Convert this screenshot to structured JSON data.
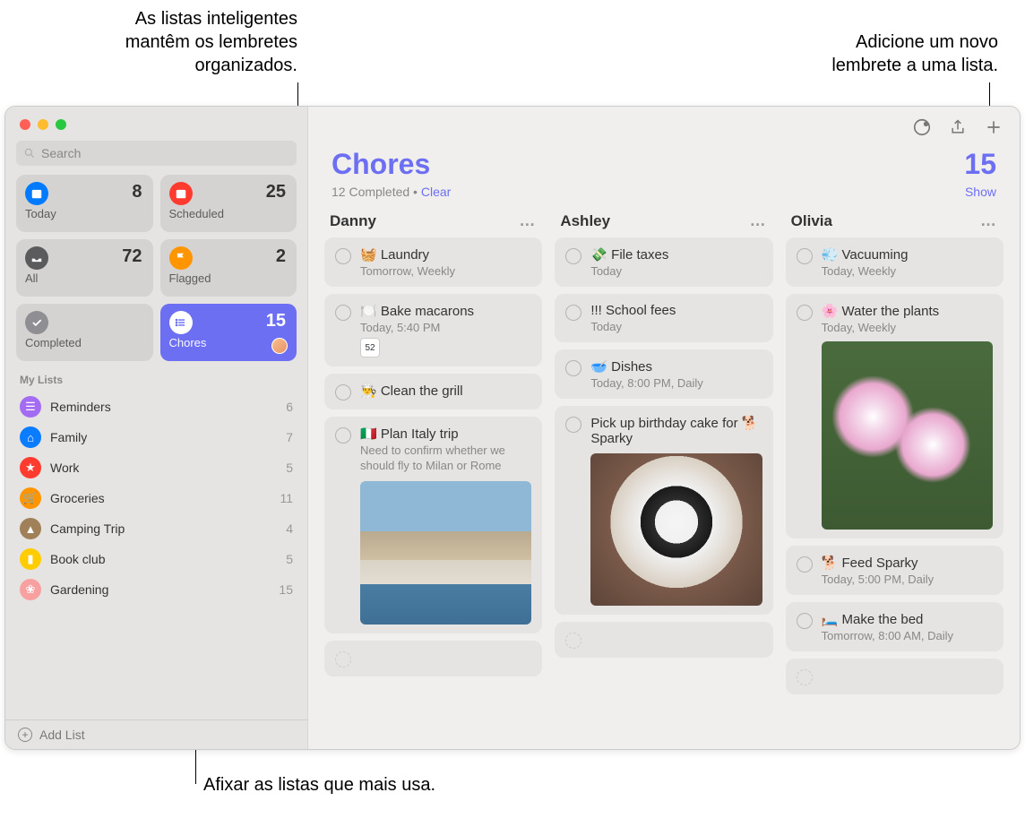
{
  "callouts": {
    "smart": "As listas inteligentes\nmantêm os lembretes\norganizados.",
    "add": "Adicione um novo\nlembrete a uma lista.",
    "pin": "Afixar as listas que mais usa."
  },
  "search": {
    "placeholder": "Search"
  },
  "tiles": [
    {
      "label": "Today",
      "count": "8"
    },
    {
      "label": "Scheduled",
      "count": "25"
    },
    {
      "label": "All",
      "count": "72"
    },
    {
      "label": "Flagged",
      "count": "2"
    },
    {
      "label": "Completed",
      "count": ""
    },
    {
      "label": "Chores",
      "count": "15"
    }
  ],
  "section": "My Lists",
  "lists": [
    {
      "name": "Reminders",
      "count": "6",
      "color": "#a46cf2",
      "glyph": "list"
    },
    {
      "name": "Family",
      "count": "7",
      "color": "#0a7cff",
      "glyph": "home"
    },
    {
      "name": "Work",
      "count": "5",
      "color": "#ff3b30",
      "glyph": "star"
    },
    {
      "name": "Groceries",
      "count": "11",
      "color": "#ff9500",
      "glyph": "cart"
    },
    {
      "name": "Camping Trip",
      "count": "4",
      "color": "#a08058",
      "glyph": "tent"
    },
    {
      "name": "Book club",
      "count": "5",
      "color": "#ffcc00",
      "glyph": "book"
    },
    {
      "name": "Gardening",
      "count": "15",
      "color": "#f8a0a0",
      "glyph": "leaf"
    }
  ],
  "add_list": "Add List",
  "header": {
    "title": "Chores",
    "count": "15",
    "completed": "12 Completed",
    "dot": "  •  ",
    "clear": "Clear",
    "show": "Show"
  },
  "columns": [
    {
      "name": "Danny",
      "items": [
        {
          "emoji": "🧺",
          "title": "Laundry",
          "sub": "Tomorrow, Weekly"
        },
        {
          "emoji": "🍽️",
          "title": "Bake macarons",
          "sub": "Today, 5:40 PM",
          "cal": "52"
        },
        {
          "emoji": "👨‍🍳",
          "title": "Clean the grill"
        },
        {
          "emoji": "🇮🇹",
          "title": "Plan Italy trip",
          "note": "Need to confirm whether we should fly to Milan or Rome",
          "img": "italy"
        },
        {
          "empty": true
        }
      ]
    },
    {
      "name": "Ashley",
      "items": [
        {
          "emoji": "💸",
          "title": "File taxes",
          "sub": "Today"
        },
        {
          "priority": "!!!",
          "title": "School fees",
          "sub": "Today"
        },
        {
          "emoji": "🥣",
          "title": "Dishes",
          "sub": "Today, 8:00 PM, Daily"
        },
        {
          "title": "Pick up birthday cake for 🐕 Sparky",
          "img": "dog"
        },
        {
          "empty": true
        }
      ]
    },
    {
      "name": "Olivia",
      "items": [
        {
          "emoji": "💨",
          "title": "Vacuuming",
          "sub": "Today, Weekly"
        },
        {
          "emoji": "🌸",
          "title": "Water the plants",
          "sub": "Today, Weekly",
          "img": "flower"
        },
        {
          "emoji": "🐕",
          "title": "Feed Sparky",
          "sub": "Today, 5:00 PM, Daily"
        },
        {
          "emoji": "🛏️",
          "title": "Make the bed",
          "sub": "Tomorrow, 8:00 AM, Daily"
        },
        {
          "empty": true
        }
      ]
    }
  ]
}
